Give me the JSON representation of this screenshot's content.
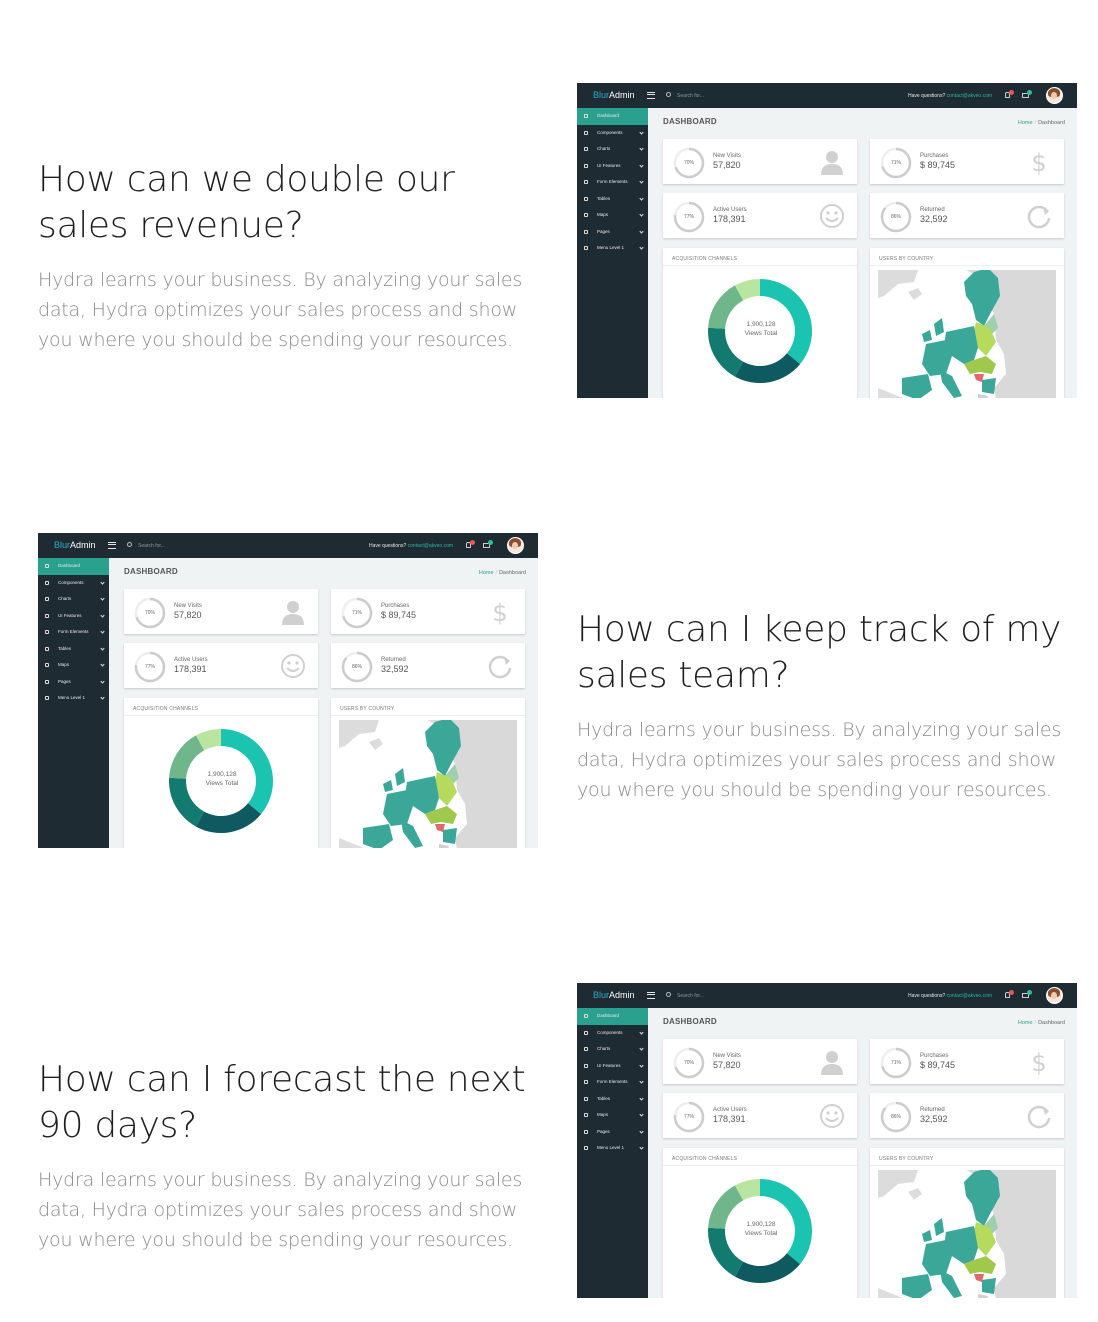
{
  "sections": [
    {
      "heading": "How can we double our sales revenue?",
      "body": "Hydra learns your business. By analyzing your sales data, Hydra optimizes your sales process and show you where you should be spending your resources."
    },
    {
      "heading": "How can I keep track of my sales team?",
      "body": "Hydra learns your business. By analyzing your sales data, Hydra optimizes your sales process and show you where you should be spending your resources."
    },
    {
      "heading": "How can I forecast the next 90 days?",
      "body": "Hydra learns your business. By analyzing your sales data, Hydra optimizes your sales process and show you where you should be spending your resources."
    }
  ],
  "dashboard": {
    "brand_a": "Blur",
    "brand_b": "Admin",
    "search_placeholder": "Search for...",
    "question_text": "Have questions?",
    "contact_email": "contact@akveo.com",
    "page_title": "DASHBOARD",
    "breadcrumb_home": "Home",
    "breadcrumb_current": "Dashboard",
    "sidebar_items": [
      "Dashboard",
      "Components",
      "Charts",
      "UI Features",
      "Form Elements",
      "Tables",
      "Maps",
      "Pages",
      "Menu Level 1"
    ],
    "stats": [
      {
        "percent": "70%",
        "percent_value": 70,
        "label": "New Visits",
        "value": "57,820",
        "icon": "person-icon"
      },
      {
        "percent": "71%",
        "percent_value": 71,
        "label": "Purchases",
        "value": "$ 89,745",
        "icon": "dollar-icon"
      },
      {
        "percent": "77%",
        "percent_value": 77,
        "label": "Active Users",
        "value": "178,391",
        "icon": "smiley-icon"
      },
      {
        "percent": "86%",
        "percent_value": 86,
        "label": "Returned",
        "value": "32,592",
        "icon": "refresh-icon"
      }
    ],
    "acquisition_title": "ACQUISITION CHANNELS",
    "donut_value": "1,900,128",
    "donut_label": "Views Total",
    "donut_segment_colors": [
      "#1bc4b0",
      "#0f5a60",
      "#137a6f",
      "#6fb68b",
      "#b8e6a0"
    ],
    "users_by_country_title": "USERS BY COUNTRY",
    "colors": {
      "topbar": "#1f2b33",
      "accent": "#2aa08f",
      "ring": "#cccccc"
    }
  }
}
